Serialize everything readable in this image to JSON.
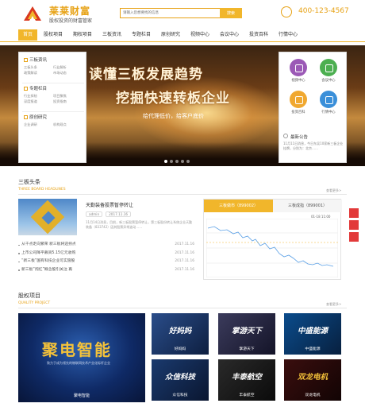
{
  "header": {
    "logo_title": "莱莱财富",
    "logo_sub": "股权投资的财富管家",
    "search_placeholder": "请输入您想要找的信息",
    "search_button": "搜索",
    "phone": "400-123-4567"
  },
  "nav": {
    "items": [
      "首页",
      "股权项目",
      "期权项目",
      "三板资讯",
      "专题栏目",
      "原创研究",
      "视频中心",
      "会议中心",
      "投资百科",
      "行情中心"
    ],
    "active_index": 0
  },
  "banner": {
    "headline_1": "读懂三板发展趋势",
    "headline_2": "挖掘快速转板企业",
    "tagline": "给代理低价，给客户底价"
  },
  "left_panel": {
    "groups": [
      {
        "title": "三板资讯",
        "links": [
          "三板头条",
          "行业解析",
          "政策解读",
          "市场动态"
        ]
      },
      {
        "title": "专题栏目",
        "links": [
          "行业探秘",
          "项目聚焦",
          "深度报道",
          "投资指南"
        ]
      },
      {
        "title": "原创研究",
        "links": [
          "企业调研",
          "机构观点"
        ]
      }
    ]
  },
  "right_panel": {
    "tiles": [
      {
        "label": "视频中心",
        "color": "#9b59b6"
      },
      {
        "label": "会议中心",
        "color": "#4caf50"
      },
      {
        "label": "投资百科",
        "color": "#f0a830"
      },
      {
        "label": "行情中心",
        "color": "#3a8fd9"
      }
    ],
    "notice_title": "最新公告",
    "notice_text": "11月11日消息，今日东吴10家新三板企业挂牌，分别为：北京……"
  },
  "headlines": {
    "title": "三板头条",
    "subtitle": "THREE BOARD HEADLINES",
    "more": "查看更多>",
    "feature": {
      "title": "天勤装备股票暂停转让",
      "tag": "admin",
      "date": "2017.11.16",
      "desc": "11月14日消息，目前，新三板股票暂停转让，第三板股份转让系统企业天勤装备（833742）因其股票异常波动……"
    },
    "news": [
      {
        "title": "从千点走向繁荣 新三板将迎拐点",
        "date": "2017.11.16"
      },
      {
        "title": "上市公司降平募资5.15亿元收购",
        "date": "2017.11.16"
      },
      {
        "title": "“新三板”国有科技企业可实施股",
        "date": "2017.11.16"
      },
      {
        "title": "新三板“闯红”概念股引关注 再",
        "date": "2017.11.16"
      }
    ]
  },
  "stock": {
    "tab_1": "三板做市（899002）",
    "tab_2": "三板成指（899001）",
    "date": "01-18  11:00"
  },
  "projects": {
    "title": "股权项目",
    "subtitle": "QUALITY PROJECT",
    "more": "查看更多>",
    "big": {
      "title": "聚电智能",
      "sub": "致力于成为领先的物联网技术产业化标杆企业",
      "caption": "聚电智能"
    },
    "tiles": [
      {
        "title": "好妈妈",
        "caption": "好妈妈",
        "bg": "#2a4d8a"
      },
      {
        "title": "掌游天下",
        "caption": "掌游天下",
        "bg": "#3b3b5c"
      },
      {
        "title": "中盛能源",
        "caption": "中盛能源",
        "bg": "#0b4c8c"
      },
      {
        "title": "众信科技",
        "caption": "众信科技",
        "bg": "#1a3a6e"
      },
      {
        "title": "丰泰航空",
        "caption": "丰泰航空",
        "bg": "#2a2a2a"
      },
      {
        "title": "双龙电机",
        "caption": "双龙电机",
        "bg": "#3a0e0e"
      }
    ]
  },
  "colors": {
    "accent": "#f1b62b",
    "brand": "#e7a215",
    "side_buttons": "#e23a3a"
  }
}
